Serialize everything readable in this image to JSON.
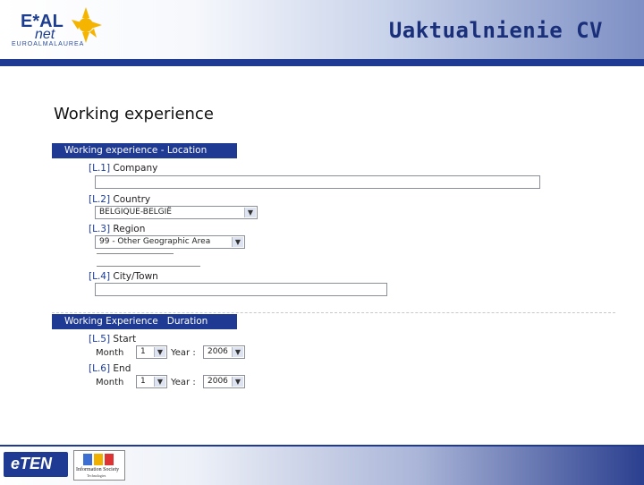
{
  "header": {
    "title": "Uaktualnienie CV",
    "logo_top": "E*AL",
    "logo_net": "net",
    "logo_sub": "EUROALMALAUREA"
  },
  "section_heading": "Working experience",
  "location": {
    "bar_label": "Working experience - Location",
    "company": {
      "code": "[L.1]",
      "label": "Company",
      "value": ""
    },
    "country": {
      "code": "[L.2]",
      "label": "Country",
      "selected": "BELGIQUE-BELGIË"
    },
    "region": {
      "code": "[L.3]",
      "label": "Region",
      "selected": "99 - Other Geographic Area"
    },
    "city": {
      "code": "[L.4]",
      "label": "City/Town",
      "value": ""
    }
  },
  "duration": {
    "bar_label": "Working Experience   Duration",
    "start": {
      "code": "[L.5]",
      "label": "Start",
      "month_label": "Month",
      "month": "1",
      "year_label": "Year :",
      "year": "2006"
    },
    "end": {
      "code": "[L.6]",
      "label": "End",
      "month_label": "Month",
      "month": "1",
      "year_label": "Year :",
      "year": "2006"
    }
  },
  "footer": {
    "eten_logo": "eTEN",
    "ist_logo_line1": "Information Society",
    "ist_logo_line2": "Technologies"
  },
  "colors": {
    "brand_blue": "#1f3a93",
    "title_blue": "#1a2f7a"
  }
}
